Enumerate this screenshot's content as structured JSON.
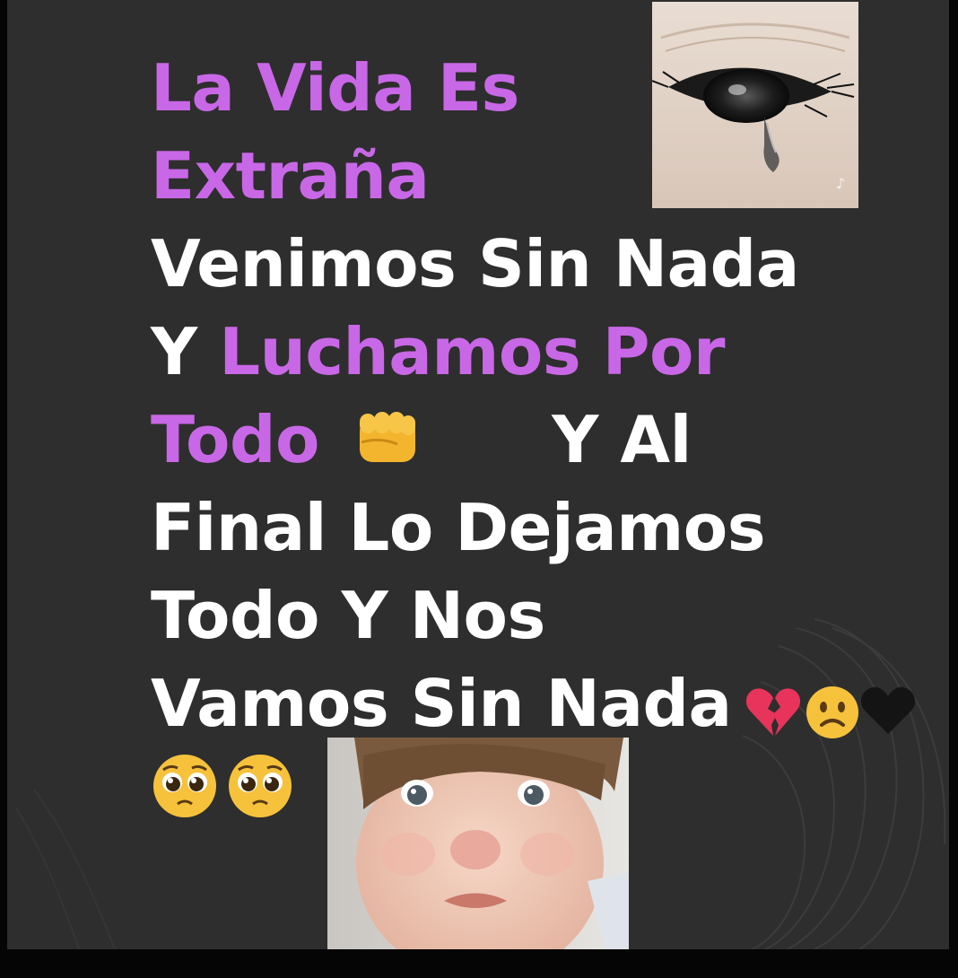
{
  "post": {
    "title_line1": "La Vida Es",
    "title_line2": "Extraña",
    "line3": "Venimos Sin Nada",
    "line4_prefix": "Y ",
    "line4_purple": "Luchamos Por",
    "line5_purple": "Todo",
    "line5_white": "Y Al",
    "line6": "Final Lo Dejamos",
    "line7": "Todo Y Nos",
    "line8": "Vamos Sin Nada"
  },
  "emojis": {
    "fist": "fist-bump-emoji",
    "broken_heart": "broken-heart-emoji",
    "frown": "frowning-face-emoji",
    "black_heart": "black-heart-emoji",
    "pleading": "pleading-face-emoji"
  },
  "colors": {
    "background": "#2e2e2e",
    "text": "#ffffff",
    "accent_purple": "#c868e6"
  }
}
